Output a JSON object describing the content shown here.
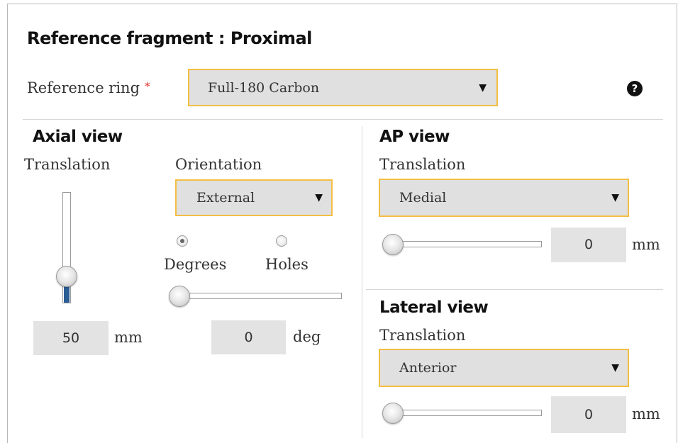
{
  "reference": {
    "title": "Reference fragment : Proximal",
    "ring_label": "Reference ring",
    "required_mark": "*",
    "ring_value": "Full-180 Carbon",
    "help_icon": "question-circle-icon"
  },
  "axial": {
    "title": "Axial view",
    "translation_label": "Translation",
    "translation_value": "50",
    "translation_unit": "mm",
    "translation_slider_fraction": 0.2,
    "orientation_label": "Orientation",
    "orientation_value": "External",
    "radio_degrees_label": "Degrees",
    "radio_holes_label": "Holes",
    "radio_selected": "Degrees",
    "angle_value": "0",
    "angle_unit": "deg"
  },
  "ap": {
    "title": "AP view",
    "translation_label": "Translation",
    "direction_value": "Medial",
    "value": "0",
    "unit": "mm"
  },
  "lateral": {
    "title": "Lateral view",
    "translation_label": "Translation",
    "direction_value": "Anterior",
    "value": "0",
    "unit": "mm"
  },
  "colors": {
    "select_border": "#f3be44",
    "select_bg": "#e0e0e0",
    "required_mark": "#d9302c",
    "slider_fill": "#2a5d93"
  }
}
